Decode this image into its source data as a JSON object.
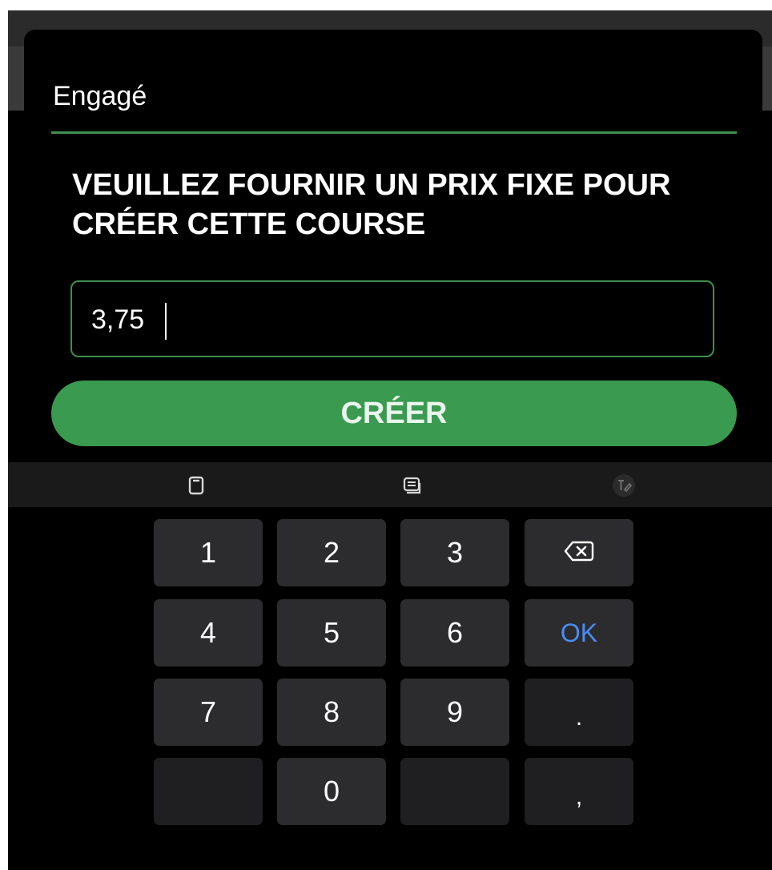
{
  "dialog": {
    "title": "Engagé",
    "prompt": "VEUILLEZ FOURNIR UN PRIX FIXE POUR CRÉER CETTE COURSE",
    "price_value": "3,75",
    "create_label": "CRÉER"
  },
  "keyboard": {
    "toolbar_icons": [
      "clipboard-icon",
      "keyboard-settings-icon",
      "handwriting-icon"
    ],
    "keys": {
      "k1": "1",
      "k2": "2",
      "k3": "3",
      "k4": "4",
      "k5": "5",
      "k6": "6",
      "k7": "7",
      "k8": "8",
      "k9": "9",
      "k0": "0",
      "ok": "OK",
      "dot": ".",
      "comma": ","
    },
    "backspace_icon": "backspace-icon"
  },
  "colors": {
    "accent_green": "#3a9a4f",
    "field_border": "#3e8e4d",
    "ok_blue": "#4a8cf0",
    "key_bg": "#2c2c2e"
  }
}
